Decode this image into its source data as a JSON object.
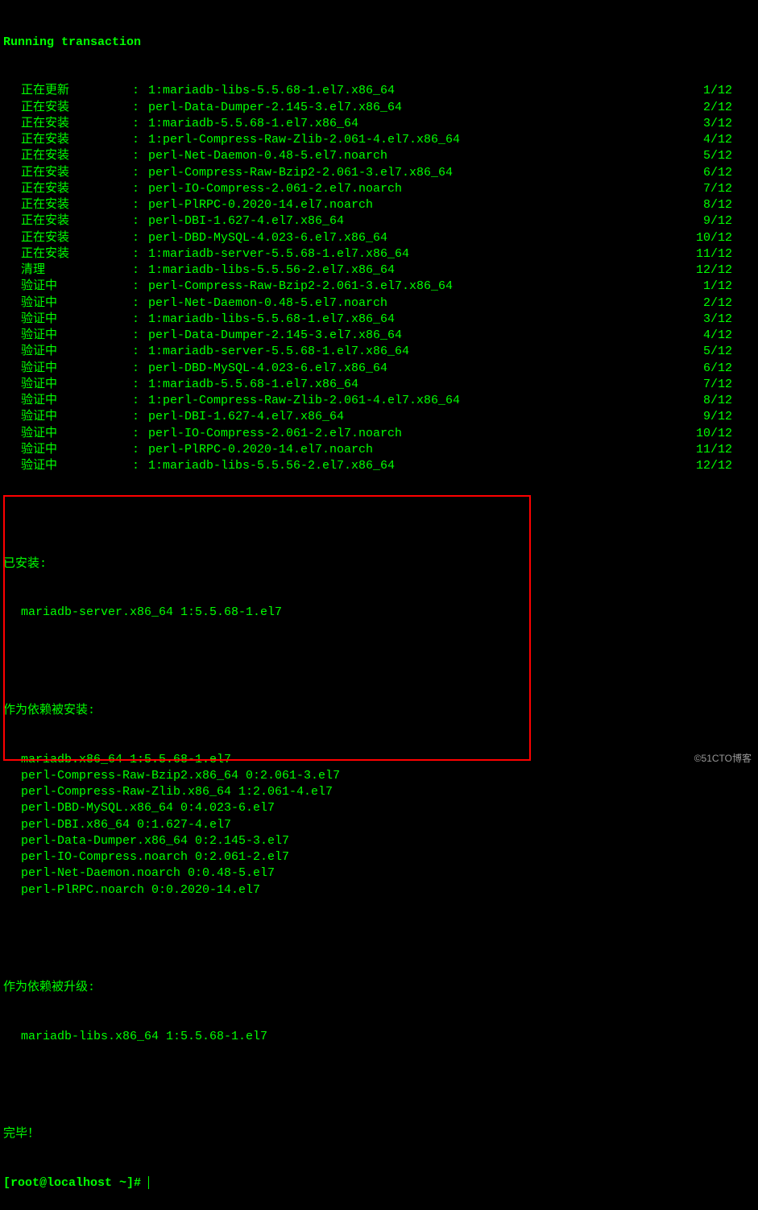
{
  "header": "Running transaction",
  "rows": [
    {
      "action": "正在更新",
      "pkg": "1:mariadb-libs-5.5.68-1.el7.x86_64",
      "count": " 1/12"
    },
    {
      "action": "正在安装",
      "pkg": "perl-Data-Dumper-2.145-3.el7.x86_64",
      "count": " 2/12"
    },
    {
      "action": "正在安装",
      "pkg": "1:mariadb-5.5.68-1.el7.x86_64",
      "count": " 3/12"
    },
    {
      "action": "正在安装",
      "pkg": "1:perl-Compress-Raw-Zlib-2.061-4.el7.x86_64",
      "count": " 4/12"
    },
    {
      "action": "正在安装",
      "pkg": "perl-Net-Daemon-0.48-5.el7.noarch",
      "count": " 5/12"
    },
    {
      "action": "正在安装",
      "pkg": "perl-Compress-Raw-Bzip2-2.061-3.el7.x86_64",
      "count": " 6/12"
    },
    {
      "action": "正在安装",
      "pkg": "perl-IO-Compress-2.061-2.el7.noarch",
      "count": " 7/12"
    },
    {
      "action": "正在安装",
      "pkg": "perl-PlRPC-0.2020-14.el7.noarch",
      "count": " 8/12"
    },
    {
      "action": "正在安装",
      "pkg": "perl-DBI-1.627-4.el7.x86_64",
      "count": " 9/12"
    },
    {
      "action": "正在安装",
      "pkg": "perl-DBD-MySQL-4.023-6.el7.x86_64",
      "count": "10/12"
    },
    {
      "action": "正在安装",
      "pkg": "1:mariadb-server-5.5.68-1.el7.x86_64",
      "count": "11/12"
    },
    {
      "action": "清理",
      "pkg": "1:mariadb-libs-5.5.56-2.el7.x86_64",
      "count": "12/12"
    },
    {
      "action": "验证中",
      "pkg": "perl-Compress-Raw-Bzip2-2.061-3.el7.x86_64",
      "count": " 1/12"
    },
    {
      "action": "验证中",
      "pkg": "perl-Net-Daemon-0.48-5.el7.noarch",
      "count": " 2/12"
    },
    {
      "action": "验证中",
      "pkg": "1:mariadb-libs-5.5.68-1.el7.x86_64",
      "count": " 3/12"
    },
    {
      "action": "验证中",
      "pkg": "perl-Data-Dumper-2.145-3.el7.x86_64",
      "count": " 4/12"
    },
    {
      "action": "验证中",
      "pkg": "1:mariadb-server-5.5.68-1.el7.x86_64",
      "count": " 5/12"
    },
    {
      "action": "验证中",
      "pkg": "perl-DBD-MySQL-4.023-6.el7.x86_64",
      "count": " 6/12"
    },
    {
      "action": "验证中",
      "pkg": "1:mariadb-5.5.68-1.el7.x86_64",
      "count": " 7/12"
    },
    {
      "action": "验证中",
      "pkg": "1:perl-Compress-Raw-Zlib-2.061-4.el7.x86_64",
      "count": " 8/12"
    },
    {
      "action": "验证中",
      "pkg": "perl-DBI-1.627-4.el7.x86_64",
      "count": " 9/12"
    },
    {
      "action": "验证中",
      "pkg": "perl-IO-Compress-2.061-2.el7.noarch",
      "count": "10/12"
    },
    {
      "action": "验证中",
      "pkg": "perl-PlRPC-0.2020-14.el7.noarch",
      "count": "11/12"
    },
    {
      "action": "验证中",
      "pkg": "1:mariadb-libs-5.5.56-2.el7.x86_64",
      "count": "12/12"
    }
  ],
  "installed_header": "已安装:",
  "installed_items": [
    "mariadb-server.x86_64 1:5.5.68-1.el7"
  ],
  "dep_installed_header": "作为依赖被安装:",
  "dep_installed_items": [
    "mariadb.x86_64 1:5.5.68-1.el7",
    "perl-Compress-Raw-Bzip2.x86_64 0:2.061-3.el7",
    "perl-Compress-Raw-Zlib.x86_64 1:2.061-4.el7",
    "perl-DBD-MySQL.x86_64 0:4.023-6.el7",
    "perl-DBI.x86_64 0:1.627-4.el7",
    "perl-Data-Dumper.x86_64 0:2.145-3.el7",
    "perl-IO-Compress.noarch 0:2.061-2.el7",
    "perl-Net-Daemon.noarch 0:0.48-5.el7",
    "perl-PlRPC.noarch 0:0.2020-14.el7"
  ],
  "dep_upgraded_header": "作为依赖被升级:",
  "dep_upgraded_items": [
    "mariadb-libs.x86_64 1:5.5.68-1.el7"
  ],
  "complete": "完毕！",
  "prompt": "[root@localhost ~]# ",
  "watermark": "©51CTO博客"
}
